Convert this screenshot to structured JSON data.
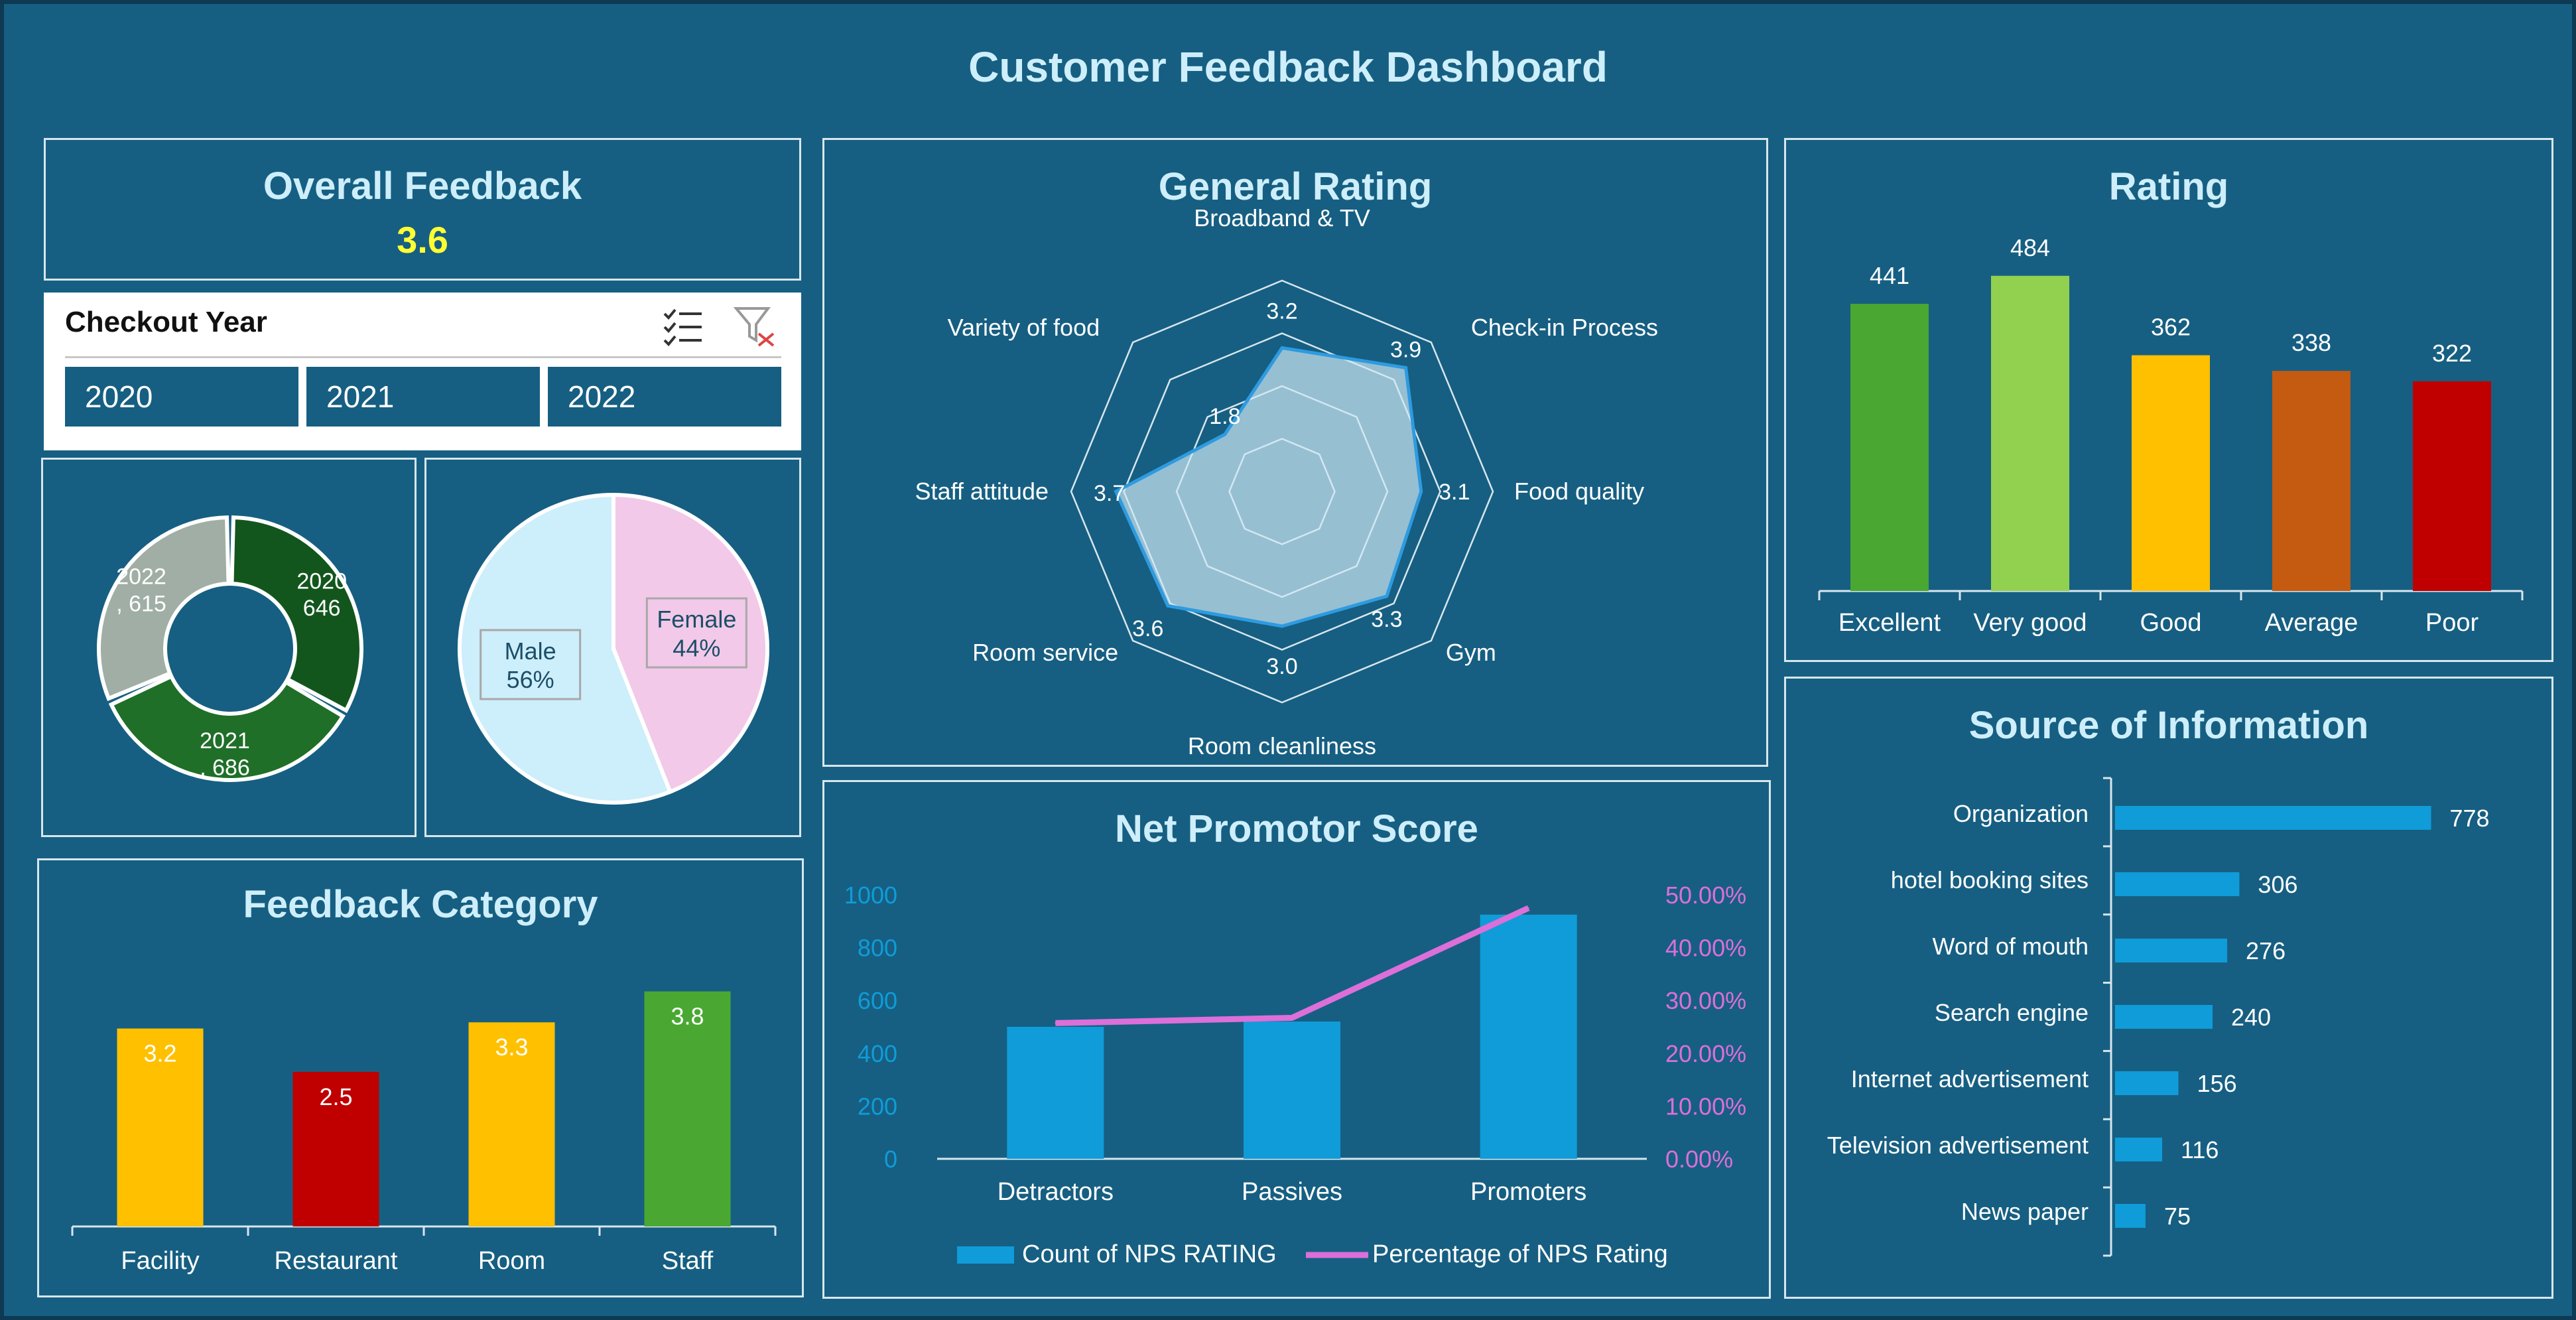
{
  "title": "Customer Feedback Dashboard",
  "overall": {
    "label": "Overall Feedback",
    "value": "3.6"
  },
  "slicer": {
    "title": "Checkout Year",
    "buttons": [
      "2020",
      "2021",
      "2022"
    ]
  },
  "colors": {
    "background": "#165f82",
    "title": "#cdeefa",
    "overall_value": "#ffff33",
    "excellent": "#4aa832",
    "very_good": "#92d050",
    "good": "#ffc000",
    "average": "#c55a11",
    "poor": "#c00000",
    "nps_bar": "#109cd8",
    "nps_line": "#dc6fd9",
    "female": "#f2c9e8",
    "male": "#cdeefb"
  },
  "chart_data": [
    {
      "id": "year_donut",
      "type": "pie",
      "categories": [
        "2020",
        "2021",
        "2022"
      ],
      "values": [
        646,
        686,
        615
      ],
      "labels": [
        "2020\n646",
        "2021\n, 686",
        "2022\n, 615"
      ]
    },
    {
      "id": "gender_pie",
      "type": "pie",
      "categories": [
        "Female",
        "Male"
      ],
      "values": [
        44,
        56
      ],
      "labels": [
        "Female\n44%",
        "Male\n56%"
      ]
    },
    {
      "id": "feedback_category",
      "type": "bar",
      "title": "Feedback Category",
      "categories": [
        "Facility",
        "Restaurant",
        "Room",
        "Staff"
      ],
      "values": [
        3.2,
        2.5,
        3.3,
        3.8
      ],
      "ylim": [
        0,
        5
      ],
      "data_labels": [
        "3.2",
        "2.5",
        "3.3",
        "3.8"
      ]
    },
    {
      "id": "general_rating",
      "type": "radar",
      "title": "General Rating",
      "categories": [
        "Broadband & TV",
        "Check-in Process",
        "Food quality",
        "Gym",
        "Room cleanliness",
        "Room service",
        "Staff attitude",
        "Variety of food"
      ],
      "values": [
        3.2,
        3.9,
        3.1,
        3.3,
        3.0,
        3.6,
        3.7,
        1.8
      ],
      "data_labels": [
        "3.2",
        "3.9",
        "3.1",
        "3.3",
        "3.0",
        "3.6",
        "3.7",
        "1.8"
      ],
      "range": [
        0,
        4.7
      ],
      "rings": 4
    },
    {
      "id": "nps",
      "type": "bar",
      "title": "Net Promotor Score",
      "categories": [
        "Detractors",
        "Passives",
        "Promoters"
      ],
      "series": [
        {
          "name": "Count of NPS RATING",
          "values": [
            500,
            520,
            925
          ],
          "axis": "left"
        },
        {
          "name": "Percentage of NPS Rating",
          "values": [
            0.257,
            0.267,
            0.475
          ],
          "axis": "right",
          "kind": "line"
        }
      ],
      "y_left": {
        "range": [
          0,
          1000
        ],
        "ticks": [
          "0",
          "200",
          "400",
          "600",
          "800",
          "1000"
        ]
      },
      "y_right": {
        "range": [
          0,
          0.5
        ],
        "ticks": [
          "0.00%",
          "10.00%",
          "20.00%",
          "30.00%",
          "40.00%",
          "50.00%"
        ]
      },
      "legend_position": "bottom"
    },
    {
      "id": "rating",
      "type": "bar",
      "title": "Rating",
      "categories": [
        "Excellent",
        "Very good",
        "Good",
        "Average",
        "Poor"
      ],
      "values": [
        441,
        484,
        362,
        338,
        322
      ],
      "data_labels": [
        "441",
        "484",
        "362",
        "338",
        "322"
      ],
      "ylim": [
        0,
        550
      ]
    },
    {
      "id": "source",
      "type": "bar",
      "orientation": "horizontal",
      "title": "Source of Information",
      "categories": [
        "Organization",
        "hotel booking sites",
        "Word of mouth",
        "Search engine",
        "Internet advertisement",
        "Television advertisement",
        "News paper"
      ],
      "values": [
        778,
        306,
        276,
        240,
        156,
        116,
        75
      ],
      "data_labels": [
        "778",
        "306",
        "276",
        "240",
        "156",
        "116",
        "75"
      ],
      "xlim": [
        0,
        800
      ]
    }
  ]
}
